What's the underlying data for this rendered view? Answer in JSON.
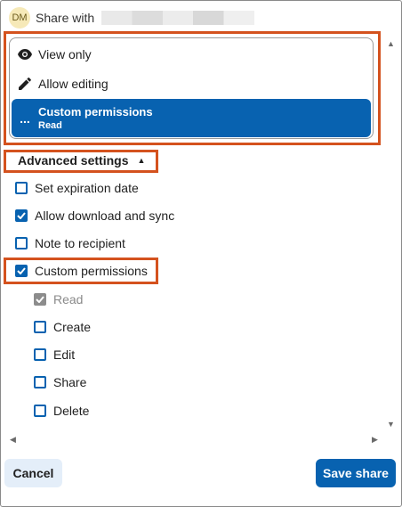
{
  "header": {
    "avatar_initials": "DM",
    "share_with_label": "Share with"
  },
  "permissions": {
    "options": [
      {
        "label": "View only",
        "icon": "eye-icon"
      },
      {
        "label": "Allow editing",
        "icon": "pencil-icon"
      }
    ],
    "selected": {
      "label": "Custom permissions",
      "sub": "Read",
      "icon": "more-icon",
      "icon_text": "..."
    }
  },
  "advanced": {
    "label": "Advanced settings",
    "caret": "▲"
  },
  "settings": [
    {
      "label": "Set expiration date",
      "checked": false
    },
    {
      "label": "Allow download and sync",
      "checked": true
    },
    {
      "label": "Note to recipient",
      "checked": false
    },
    {
      "label": "Custom permissions",
      "checked": true
    }
  ],
  "custom_permissions": [
    {
      "label": "Read",
      "checked": true,
      "disabled": true
    },
    {
      "label": "Create",
      "checked": false
    },
    {
      "label": "Edit",
      "checked": false
    },
    {
      "label": "Share",
      "checked": false
    },
    {
      "label": "Delete",
      "checked": false
    }
  ],
  "scroll": {
    "up": "▲",
    "down": "▼",
    "left": "◀",
    "right": "▶"
  },
  "footer": {
    "cancel_label": "Cancel",
    "save_label": "Save share"
  },
  "colors": {
    "accent": "#0862b0",
    "highlight": "#d4521e",
    "avatar_bg": "#f6e9b8"
  }
}
